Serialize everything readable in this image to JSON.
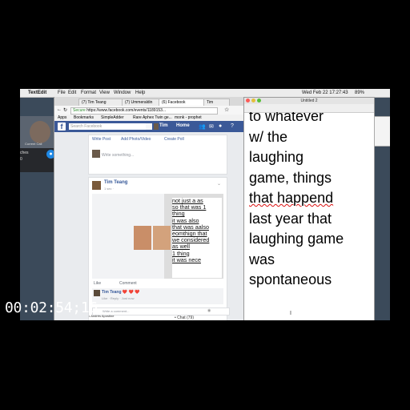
{
  "menubar": {
    "app": "TextEdit",
    "items": [
      "File",
      "Edit",
      "Format",
      "View",
      "Window",
      "Help"
    ],
    "clock": "Wed Feb 22 17:27:43",
    "battery": "89%"
  },
  "call": {
    "label": "Current Call",
    "name_line1": "ches",
    "name_line2": "0"
  },
  "browser": {
    "tabs": [
      "(7) Tim Teang",
      "(7) Ummeraldin",
      "(6) Facebook",
      "Tim"
    ],
    "url_secure": "Secure",
    "url": "https://www.facebook.com/events/1189153...",
    "bookmarks": [
      "Apps",
      "Bookmarks",
      "SimpleAdder",
      "Rare Aphex Twin ge...",
      "monk - prophet"
    ]
  },
  "facebook": {
    "search_placeholder": "Search Facebook",
    "user": "Tim",
    "home": "Home",
    "composer_tabs": [
      "Write Post",
      "Add Photo/Video",
      "Create Poll"
    ],
    "composer_placeholder": "Write something...",
    "post_author": "Tim Teang",
    "post_time": "1 sec · ",
    "post_lines": [
      "not just a as",
      "so that was 1",
      "thing",
      "it was also",
      "that was aalso",
      "eomthign that",
      "we considered",
      "as well",
      "1 thing",
      "it was nece"
    ],
    "actions": [
      "Like",
      "Comment"
    ],
    "reply_author": "Tim Teang ❤️ ❤️ ❤️",
    "reply_meta": "Like · Reply · Just now",
    "comment_placeholder": "Write a comment...",
    "footer_name": "• Andrés Apostine",
    "chat": "• Chat (79)"
  },
  "editor": {
    "title": "Untitled 2",
    "lines": [
      "to whatever",
      "w/ the",
      "laughing",
      "game, things",
      "that happend",
      "last year that",
      "laughing game",
      "was",
      "spontaneous"
    ],
    "cursor": "I"
  },
  "timecode": "00:02:54;16"
}
